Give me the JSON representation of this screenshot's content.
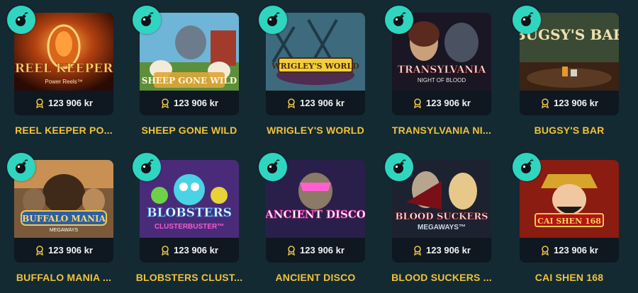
{
  "games": [
    {
      "title": "REEL KEEPER PO...",
      "prize": "123 906 kr",
      "logo": "REEL KEEPER",
      "sub": "Power Reels™"
    },
    {
      "title": "SHEEP GONE WILD",
      "prize": "123 906 kr",
      "logo": "SHEEP GONE WILD",
      "sub": ""
    },
    {
      "title": "WRIGLEY'S WORLD",
      "prize": "123 906 kr",
      "logo": "WRIGLEY'S WORLD",
      "sub": ""
    },
    {
      "title": "TRANSYLVANIA NI...",
      "prize": "123 906 kr",
      "logo": "TRANSYLVANIA",
      "sub": "NIGHT OF BLOOD"
    },
    {
      "title": "BUGSY'S BAR",
      "prize": "123 906 kr",
      "logo": "BUGSY'S BAR",
      "sub": ""
    },
    {
      "title": "BUFFALO MANIA ...",
      "prize": "123 906 kr",
      "logo": "BUFFALO MANIA",
      "sub": "MEGAWAYS"
    },
    {
      "title": "BLOBSTERS CLUST...",
      "prize": "123 906 kr",
      "logo": "BLOBSTERS",
      "sub": "CLUSTERBUSTER™"
    },
    {
      "title": "ANCIENT DISCO",
      "prize": "123 906 kr",
      "logo": "ANCIENT DISCO",
      "sub": ""
    },
    {
      "title": "BLOOD SUCKERS ...",
      "prize": "123 906 kr",
      "logo": "BLOOD SUCKERS",
      "sub": "MEGAWAYS™"
    },
    {
      "title": "CAI SHEN 168",
      "prize": "123 906 kr",
      "logo": "CAI SHEN 168",
      "sub": ""
    }
  ],
  "icons": {
    "badge": "bomb-icon",
    "prize": "trophy-icon"
  },
  "colors": {
    "background": "#132a33",
    "badge": "#2fd5bf",
    "title": "#f0c23a",
    "prize_bar": "#0f1720"
  }
}
